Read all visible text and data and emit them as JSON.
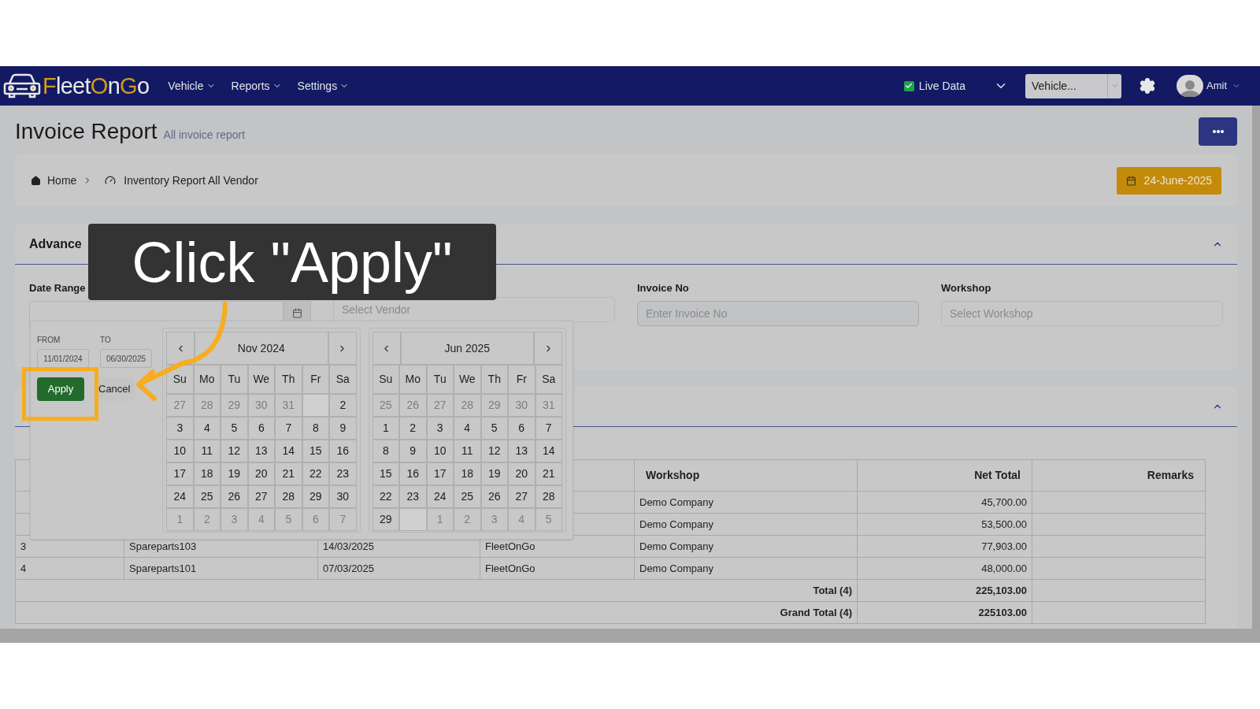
{
  "navbar": {
    "logo_parts": [
      {
        "text": "F",
        "accent": true
      },
      {
        "text": "leet",
        "accent": false
      },
      {
        "text": "O",
        "accent": true
      },
      {
        "text": "n",
        "accent": false
      },
      {
        "text": "G",
        "accent": true
      },
      {
        "text": "o",
        "accent": false
      }
    ],
    "menus": [
      "Vehicle",
      "Reports",
      "Settings"
    ],
    "live_data": {
      "label": "Live Data",
      "checked": true
    },
    "vehicle_select": {
      "value": "Vehicle..."
    },
    "user": "Amit"
  },
  "page": {
    "title": "Invoice Report",
    "subtitle": "All invoice report"
  },
  "breadcrumb": {
    "items": [
      "Home",
      "Inventory Report All Vendor"
    ],
    "date_button": "24-June-2025"
  },
  "search": {
    "title": "Advance",
    "expanded": true,
    "fields": [
      {
        "label": "Date Range",
        "kind": "date"
      },
      {
        "placeholder": "Select Vendor",
        "kind": "select"
      },
      {
        "label": "Invoice No",
        "placeholder": "Enter Invoice No",
        "kind": "text"
      },
      {
        "label": "Workshop",
        "placeholder": "Select Workshop",
        "kind": "select"
      }
    ]
  },
  "results": {
    "expanded": true,
    "columns": [
      "Workshop",
      "Net Total",
      "Remarks"
    ],
    "rows": [
      {
        "workshop": "Demo Company",
        "net_total": "45,700.00"
      },
      {
        "workshop": "Demo Company",
        "net_total": "53,500.00"
      },
      {
        "column_1": "3",
        "column_2": "Spareparts103",
        "column_3": "14/03/2025",
        "column_4": "FleetOnGo",
        "workshop": "Demo Company",
        "net_total": "77,903.00"
      },
      {
        "column_1": "4",
        "column_2": "Spareparts101",
        "column_3": "07/03/2025",
        "column_4": "FleetOnGo",
        "workshop": "Demo Company",
        "net_total": "48,000.00"
      }
    ],
    "totals": [
      {
        "label": "Total (4)",
        "value": "225,103.00"
      },
      {
        "label": "Grand Total (4)",
        "value": "225103.00"
      }
    ]
  },
  "date_picker": {
    "from_label": "FROM",
    "to_label": "TO",
    "from": "11/01/2024",
    "to": "06/30/2025",
    "apply": "Apply",
    "cancel": "Cancel",
    "calendars": [
      {
        "title": "Nov 2024",
        "weekdays": [
          "Su",
          "Mo",
          "Tu",
          "We",
          "Th",
          "Fr",
          "Sa"
        ],
        "weeks": [
          [
            {
              "kind": "muted",
              "day": "27"
            },
            {
              "kind": "muted",
              "day": "28"
            },
            {
              "kind": "muted",
              "day": "29"
            },
            {
              "kind": "muted",
              "day": "30"
            },
            {
              "kind": "muted",
              "day": "31"
            },
            {
              "kind": "range-end"
            },
            {
              "kind": "day",
              "day": "2"
            }
          ],
          [
            {
              "kind": "day",
              "day": "3"
            },
            {
              "kind": "day",
              "day": "4"
            },
            {
              "kind": "day",
              "day": "5"
            },
            {
              "kind": "day",
              "day": "6"
            },
            {
              "kind": "day",
              "day": "7"
            },
            {
              "kind": "day",
              "day": "8"
            },
            {
              "kind": "day",
              "day": "9"
            }
          ],
          [
            {
              "kind": "day",
              "day": "10"
            },
            {
              "kind": "day",
              "day": "11"
            },
            {
              "kind": "day",
              "day": "12"
            },
            {
              "kind": "day",
              "day": "13"
            },
            {
              "kind": "day",
              "day": "14"
            },
            {
              "kind": "day",
              "day": "15"
            },
            {
              "kind": "day",
              "day": "16"
            }
          ],
          [
            {
              "kind": "day",
              "day": "17"
            },
            {
              "kind": "day",
              "day": "18"
            },
            {
              "kind": "day",
              "day": "19"
            },
            {
              "kind": "day",
              "day": "20"
            },
            {
              "kind": "day",
              "day": "21"
            },
            {
              "kind": "day",
              "day": "22"
            },
            {
              "kind": "day",
              "day": "23"
            }
          ],
          [
            {
              "kind": "day",
              "day": "24"
            },
            {
              "kind": "day",
              "day": "25"
            },
            {
              "kind": "day",
              "day": "26"
            },
            {
              "kind": "day",
              "day": "27"
            },
            {
              "kind": "day",
              "day": "28"
            },
            {
              "kind": "day",
              "day": "29"
            },
            {
              "kind": "day",
              "day": "30"
            }
          ],
          [
            {
              "kind": "muted",
              "day": "1"
            },
            {
              "kind": "muted",
              "day": "2"
            },
            {
              "kind": "muted",
              "day": "3"
            },
            {
              "kind": "muted",
              "day": "4"
            },
            {
              "kind": "muted",
              "day": "5"
            },
            {
              "kind": "muted",
              "day": "6"
            },
            {
              "kind": "muted",
              "day": "7"
            }
          ]
        ]
      },
      {
        "title": "Jun 2025",
        "weekdays": [
          "Su",
          "Mo",
          "Tu",
          "We",
          "Th",
          "Fr",
          "Sa"
        ],
        "weeks": [
          [
            {
              "kind": "muted",
              "day": "25"
            },
            {
              "kind": "muted",
              "day": "26"
            },
            {
              "kind": "muted",
              "day": "27"
            },
            {
              "kind": "muted",
              "day": "28"
            },
            {
              "kind": "muted",
              "day": "29"
            },
            {
              "kind": "muted",
              "day": "30"
            },
            {
              "kind": "muted",
              "day": "31"
            }
          ],
          [
            {
              "kind": "day",
              "day": "1"
            },
            {
              "kind": "day",
              "day": "2"
            },
            {
              "kind": "day",
              "day": "3"
            },
            {
              "kind": "day",
              "day": "4"
            },
            {
              "kind": "day",
              "day": "5"
            },
            {
              "kind": "day",
              "day": "6"
            },
            {
              "kind": "day",
              "day": "7"
            }
          ],
          [
            {
              "kind": "day",
              "day": "8"
            },
            {
              "kind": "day",
              "day": "9"
            },
            {
              "kind": "day",
              "day": "10"
            },
            {
              "kind": "day",
              "day": "11"
            },
            {
              "kind": "day",
              "day": "12"
            },
            {
              "kind": "day",
              "day": "13"
            },
            {
              "kind": "day",
              "day": "14"
            }
          ],
          [
            {
              "kind": "day",
              "day": "15"
            },
            {
              "kind": "day",
              "day": "16"
            },
            {
              "kind": "day",
              "day": "17"
            },
            {
              "kind": "day",
              "day": "18"
            },
            {
              "kind": "day",
              "day": "19"
            },
            {
              "kind": "day",
              "day": "20"
            },
            {
              "kind": "day",
              "day": "21"
            }
          ],
          [
            {
              "kind": "day",
              "day": "22"
            },
            {
              "kind": "day",
              "day": "23"
            },
            {
              "kind": "day",
              "day": "24"
            },
            {
              "kind": "day",
              "day": "25"
            },
            {
              "kind": "day",
              "day": "26"
            },
            {
              "kind": "day",
              "day": "27"
            },
            {
              "kind": "day",
              "day": "28"
            }
          ],
          [
            {
              "kind": "day",
              "day": "29"
            },
            {
              "kind": "range-end"
            },
            {
              "kind": "muted",
              "day": "1"
            },
            {
              "kind": "muted",
              "day": "2"
            },
            {
              "kind": "muted",
              "day": "3"
            },
            {
              "kind": "muted",
              "day": "4"
            },
            {
              "kind": "muted",
              "day": "5"
            }
          ]
        ]
      }
    ]
  },
  "tutorial": {
    "callout": "Click \"Apply\""
  }
}
